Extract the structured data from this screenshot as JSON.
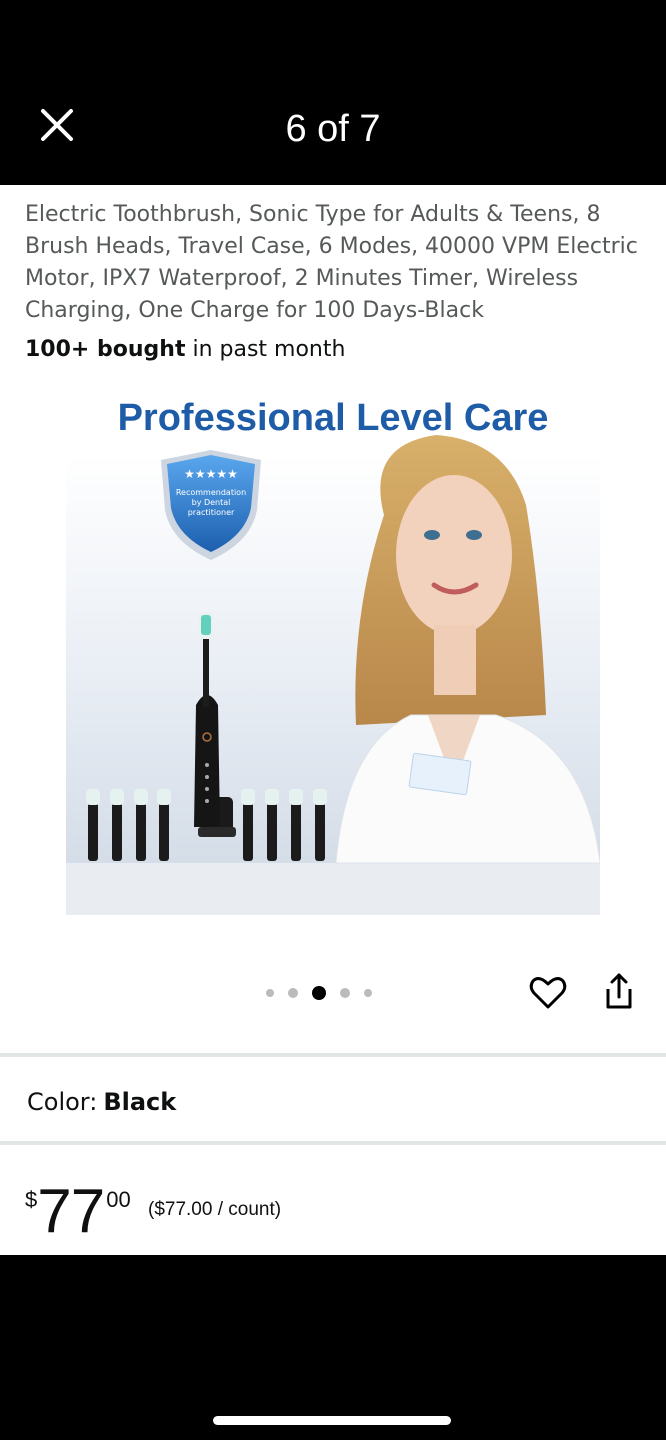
{
  "header": {
    "close_icon": "close-icon",
    "counter": "6 of 7"
  },
  "product": {
    "title": "Electric Toothbrush, Sonic Type for Adults & Teens, 8 Brush Heads, Travel Case, 6 Modes, 40000 VPM Electric Motor, IPX7 Waterproof, 2 Minutes Timer, Wireless Charging, One Charge for 100 Days-Black",
    "bought_bold": "100+ bought",
    "bought_rest": " in past month"
  },
  "image": {
    "heading": "Professional Level Care",
    "badge_line1": "Recommendation",
    "badge_line2": "by Dental",
    "badge_line3": "practitioner",
    "accent": "#1e5ca8"
  },
  "carousel": {
    "active_index": 2,
    "dot_count": 5
  },
  "actions": {
    "favorite_icon": "heart-icon",
    "share_icon": "share-icon"
  },
  "color": {
    "label": "Color:",
    "value": "Black"
  },
  "price": {
    "symbol": "$",
    "whole": "77",
    "fraction": "00",
    "unit": "($77.00 / count)"
  }
}
